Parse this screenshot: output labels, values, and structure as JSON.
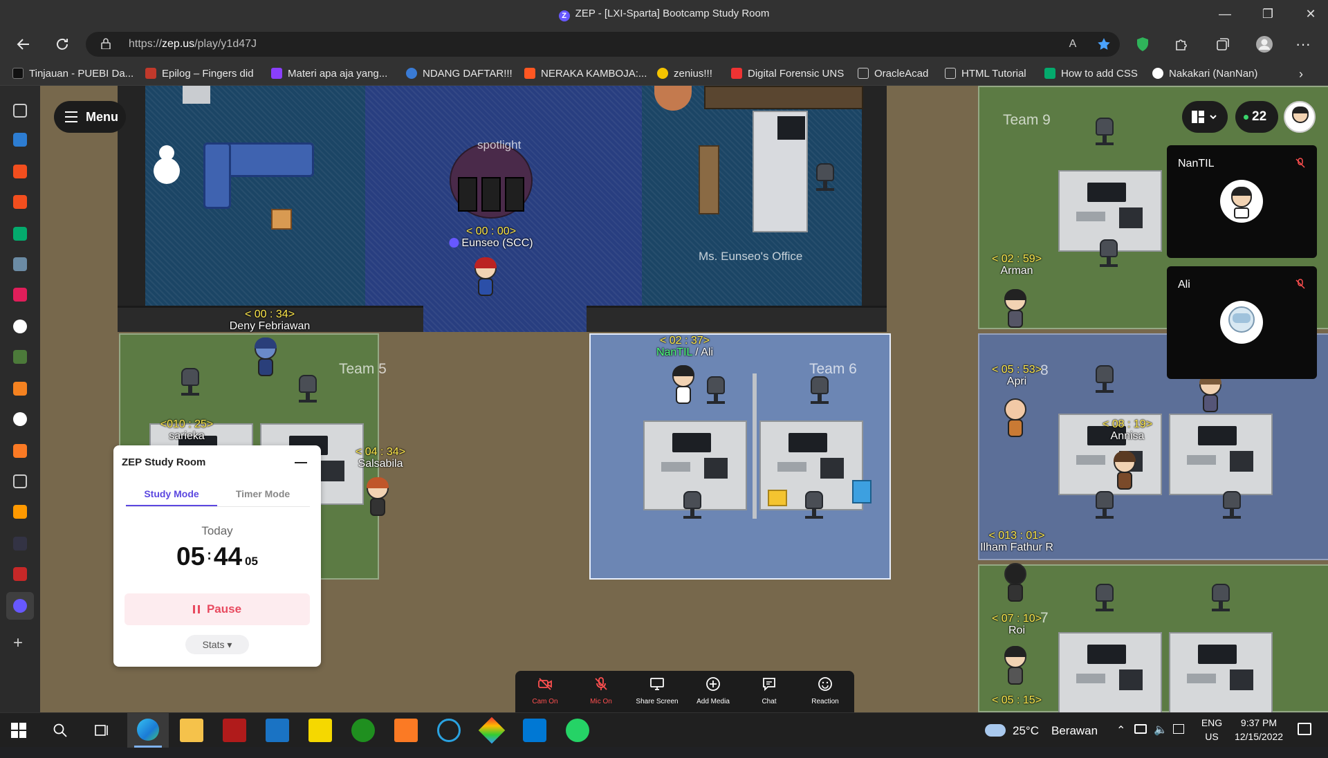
{
  "window": {
    "title": "ZEP - [LXI-Sparta] Bootcamp Study Room",
    "minimize": "—",
    "maximize": "❐",
    "close": "✕"
  },
  "navbar": {
    "url_prefix": "https://",
    "url_host": "zep.us",
    "url_path": "/play/y1d47J"
  },
  "bookmarks": [
    {
      "label": "Tinjauan - PUEBI Da...",
      "icon": "pen-icon",
      "color": "#1e1e1e"
    },
    {
      "label": "Epilog – Fingers did",
      "icon": "film-icon",
      "color": "#d23"
    },
    {
      "label": "Materi apa aja yang...",
      "icon": "zenius-icon",
      "color": "#8a3ffc"
    },
    {
      "label": "NDANG DAFTAR!!!",
      "icon": "globe-icon",
      "color": "#3a7bd5"
    },
    {
      "label": "NERAKA KAMBOJA:...",
      "icon": "blogger-icon",
      "color": "#ff5722"
    },
    {
      "label": "zenius!!!",
      "icon": "zenius-icon",
      "color": "#f5c400"
    },
    {
      "label": "Digital Forensic UNS",
      "icon": "arrow-icon",
      "color": "#e33"
    },
    {
      "label": "OracleAcad",
      "icon": "page-icon",
      "color": "#888"
    },
    {
      "label": "HTML Tutorial",
      "icon": "page-icon",
      "color": "#888"
    },
    {
      "label": "How to add CSS",
      "icon": "w3-icon",
      "color": "#04aa6d"
    },
    {
      "label": "Nakakari (NanNan)",
      "icon": "github-icon",
      "color": "#fff"
    }
  ],
  "game": {
    "menu_label": "Menu",
    "user_count": "22",
    "rooms": {
      "spotlight": "spotlight",
      "office": "Ms. Eunseo's Office",
      "team5": "Team 5",
      "team6": "Team 6",
      "team9": "Team 9",
      "team8_partial": "8",
      "team7_partial": "7"
    },
    "players": [
      {
        "time": "< 00 : 00>",
        "name": "Eunseo (SCC)",
        "crown": true
      },
      {
        "time": "< 00 : 34>",
        "name": "Deny Febriawan"
      },
      {
        "time": "< 02 : 37>",
        "name": "NanTIL",
        "name2": "Ali"
      },
      {
        "time": "<010 : 25>",
        "name": "sarieka"
      },
      {
        "time": "< 04 : 34>",
        "name": "Salsabila"
      },
      {
        "time": "< 02 : 59>",
        "name": "Arman"
      },
      {
        "time": "< 05 : 53>",
        "name": "Apri"
      },
      {
        "time": "< 08 : 19>",
        "name": "Annisa"
      },
      {
        "time": "< 013 : 01>",
        "name": "Ilham Fathur R"
      },
      {
        "time": "< 07 : 10>",
        "name": "Roi"
      },
      {
        "time": "< 05 : 15>",
        "name": ""
      }
    ],
    "video_tiles": [
      {
        "name": "NanTIL",
        "muted": true
      },
      {
        "name": "Ali",
        "muted": true
      }
    ]
  },
  "study_room": {
    "title": "ZEP Study Room",
    "tabs": [
      "Study Mode",
      "Timer Mode"
    ],
    "active_tab": "Study Mode",
    "today_label": "Today",
    "hours": "05",
    "minutes": "44",
    "seconds": "05",
    "pause_label": "Pause",
    "stats_label": "Stats ▾"
  },
  "toolbar": [
    {
      "label": "Cam On",
      "icon": "camera-off-icon",
      "off": true
    },
    {
      "label": "Mic On",
      "icon": "mic-off-icon",
      "off": true
    },
    {
      "label": "Share Screen",
      "icon": "monitor-icon",
      "off": false
    },
    {
      "label": "Add Media",
      "icon": "plus-circle-icon",
      "off": false
    },
    {
      "label": "Chat",
      "icon": "chat-icon",
      "off": false
    },
    {
      "label": "Reaction",
      "icon": "smile-icon",
      "off": false
    }
  ],
  "taskbar": {
    "weather_temp": "25°C",
    "weather_desc": "Berawan",
    "lang": "ENG",
    "region": "US",
    "time": "9:37 PM",
    "date": "12/15/2022"
  },
  "colors": {
    "accent": "#5b47e0",
    "pause_red": "#e84a5f",
    "timer_yellow": "#ffe94d",
    "online_green": "#3ad36c"
  }
}
